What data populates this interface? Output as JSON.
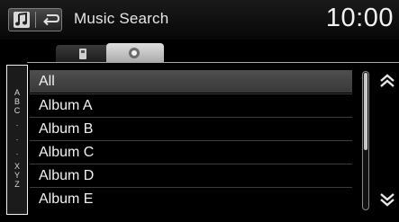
{
  "header": {
    "title": "Music Search",
    "clock": "10:00",
    "source_icon": "music-note-icon",
    "back_icon": "back-arrow-icon"
  },
  "tabs": [
    {
      "icon": "usb-device-icon",
      "active": false
    },
    {
      "icon": "disc-icon",
      "active": true
    }
  ],
  "alpha_index": [
    "A",
    "B",
    "C",
    "·",
    "·",
    "·",
    "X",
    "Y",
    "Z"
  ],
  "list": {
    "items": [
      "All",
      "Album A",
      "Album B",
      "Album C",
      "Album D",
      "Album E"
    ],
    "selected_index": 0
  },
  "scroll": {
    "up_icon": "scroll-up-icon",
    "down_icon": "scroll-down-icon"
  },
  "colors": {
    "background": "#000000",
    "text": "#f2f2f2",
    "selected_row": "#4f4f4f",
    "tab_active": "#dedede"
  }
}
